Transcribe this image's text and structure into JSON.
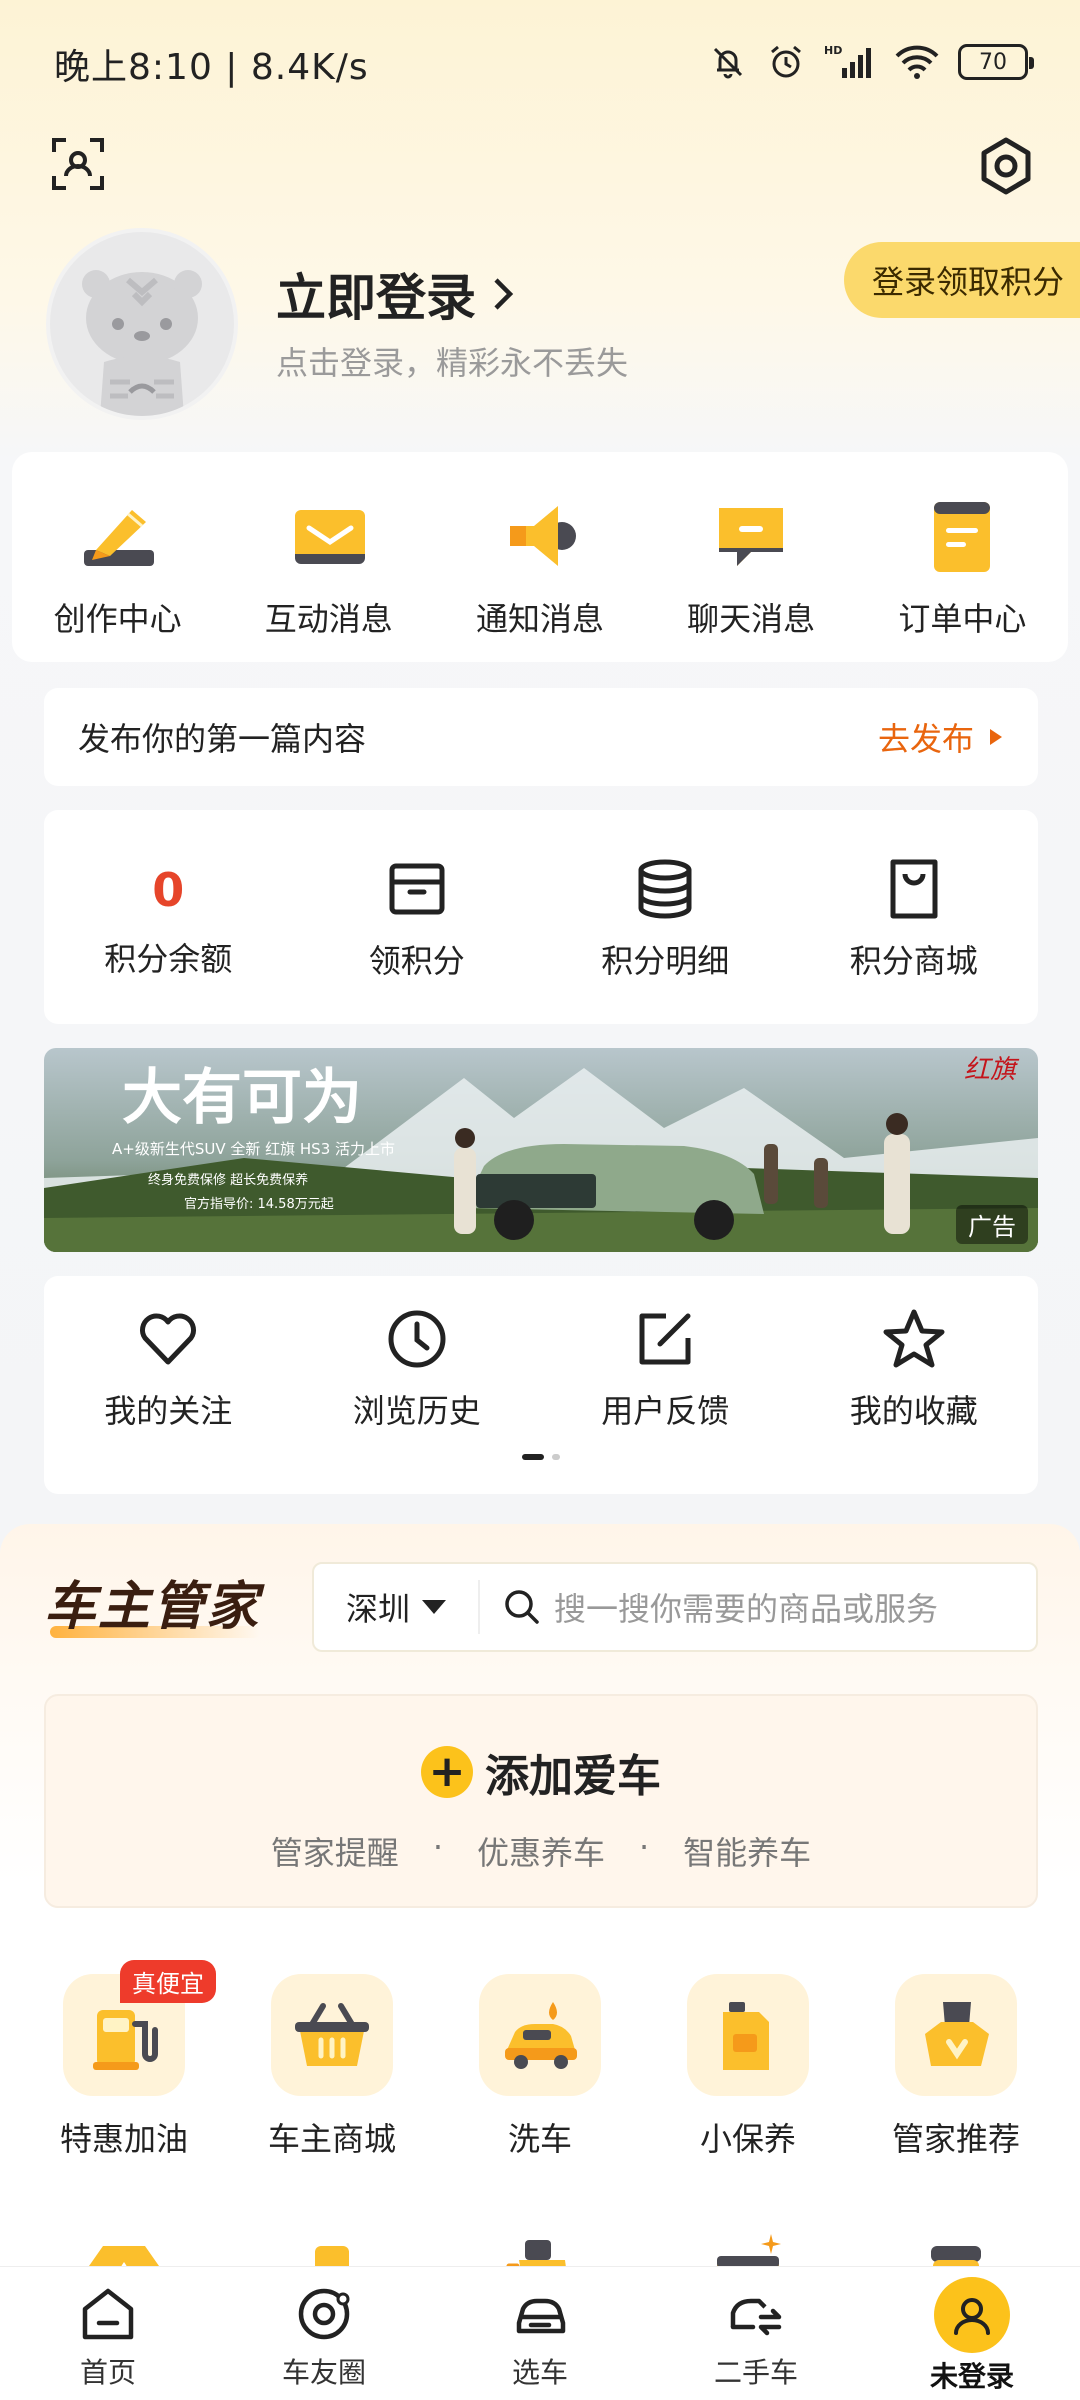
{
  "status_bar": {
    "time_speed": "晚上8:10 | 8.4K/s",
    "battery": "70"
  },
  "profile": {
    "login_title": "立即登录",
    "login_subtitle": "点击登录，精彩永不丢失",
    "points_pill": "登录领取积分"
  },
  "messages": [
    {
      "label": "创作中心",
      "icon": "pencil-icon"
    },
    {
      "label": "互动消息",
      "icon": "envelope-icon"
    },
    {
      "label": "通知消息",
      "icon": "megaphone-icon"
    },
    {
      "label": "聊天消息",
      "icon": "chat-icon"
    },
    {
      "label": "订单中心",
      "icon": "order-icon"
    }
  ],
  "publish": {
    "text": "发布你的第一篇内容",
    "action": "去发布"
  },
  "points": {
    "balance_value": "0",
    "items": [
      {
        "label": "积分余额"
      },
      {
        "label": "领积分",
        "icon": "box-icon"
      },
      {
        "label": "积分明细",
        "icon": "database-icon"
      },
      {
        "label": "积分商城",
        "icon": "shopping-bag-icon"
      }
    ]
  },
  "ad": {
    "headline": "大有可为",
    "line1": "A+级新生代SUV 全新 红旗 HS3 活力上市",
    "line2": "终身免费保修   超长免费保养",
    "line3": "官方指导价: 14.58万元起",
    "brand": "红旗",
    "badge": "广告"
  },
  "favorites": [
    {
      "label": "我的关注",
      "icon": "heart-icon"
    },
    {
      "label": "浏览历史",
      "icon": "clock-icon"
    },
    {
      "label": "用户反馈",
      "icon": "edit-icon"
    },
    {
      "label": "我的收藏",
      "icon": "star-icon"
    }
  ],
  "owner": {
    "title": "车主管家",
    "city": "深圳",
    "search_placeholder": "搜一搜你需要的商品或服务",
    "add_car": "添加爱车",
    "add_car_features": [
      "管家提醒",
      "·",
      "优惠养车",
      "·",
      "智能养车"
    ],
    "services": [
      {
        "label": "特惠加油",
        "badge": "真便宜",
        "icon": "fuel-icon"
      },
      {
        "label": "车主商城",
        "icon": "basket-icon"
      },
      {
        "label": "洗车",
        "icon": "car-wash-icon"
      },
      {
        "label": "小保养",
        "icon": "oil-can-icon"
      },
      {
        "label": "管家推荐",
        "icon": "recommend-icon"
      }
    ]
  },
  "bottom_nav": [
    {
      "label": "首页",
      "icon": "home-icon"
    },
    {
      "label": "车友圈",
      "icon": "circle-icon"
    },
    {
      "label": "选车",
      "icon": "car-icon"
    },
    {
      "label": "二手车",
      "icon": "used-car-icon"
    },
    {
      "label": "未登录",
      "icon": "user-icon"
    }
  ]
}
